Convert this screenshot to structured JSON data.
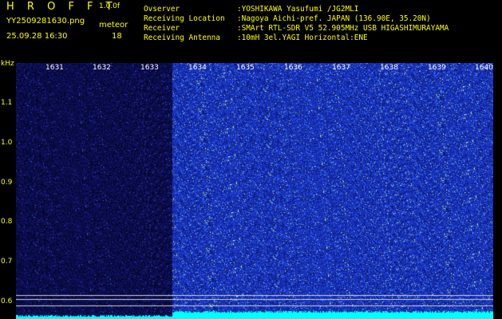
{
  "header": {
    "title": "H R O F F T",
    "version": "1.0.0f",
    "file_name": "YY2509281630.png",
    "mode": "meteor",
    "timestamp": "25.09.28 16:30",
    "meteor_count": "18"
  },
  "info": [
    {
      "key": "Ovserver",
      "value": ":YOSHIKAWA Yasufumi /JG2MLI"
    },
    {
      "key": "Receiving Location",
      "value": ":Nagoya Aichi-pref. JAPAN (136.90E, 35.20N)"
    },
    {
      "key": "Receiver",
      "value": ":SMArt RTL-SDR V5 52.905MHz USB HIGASHIMURAYAMA"
    },
    {
      "key": "Receiving Antenna",
      "value": ":10mH 3el.YAGI Horizontal:ENE"
    }
  ],
  "axes": {
    "y_unit": "kHz",
    "y_ticks": [
      "1.1",
      "1.0",
      "0.9",
      "0.8",
      "0.7",
      "0.6"
    ],
    "x_ticks": [
      "1631",
      "1632",
      "1633",
      "1634",
      "1635",
      "1636",
      "1637",
      "1638",
      "1639",
      "1640"
    ]
  },
  "colors": {
    "header_text": "#ffff00",
    "tick_text": "#ffffff",
    "background": "#000000",
    "noise_base": "#1010aa",
    "noise_hot": "#ffff60",
    "baseline_trace": "#00ffff",
    "reference_lines": "#d0d0d0"
  }
}
